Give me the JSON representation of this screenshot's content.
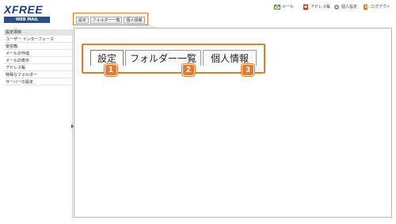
{
  "logo": {
    "word": "XFREE",
    "sub": "WEB MAIL"
  },
  "toplinks": [
    {
      "label": "メール",
      "icon": "mail-icon"
    },
    {
      "label": "アドレス帳",
      "icon": "addressbook-icon"
    },
    {
      "label": "個人設定",
      "icon": "gear-icon"
    },
    {
      "label": "ログアウト",
      "icon": "logout-icon"
    }
  ],
  "small_tabs": [
    "設定",
    "フォルダー一覧",
    "個人情報"
  ],
  "sidebar": {
    "heading": "設定項目",
    "items": [
      "ユーザー インターフェース",
      "受信箱",
      "メールの作成",
      "メールの表示",
      "アドレス帳",
      "特殊なフォルダー",
      "サーバーの設定"
    ]
  },
  "big_tabs": [
    "設定",
    "フォルダー一覧",
    "個人情報"
  ],
  "callout_numbers": [
    "1",
    "2",
    "3"
  ],
  "colors": {
    "accent": "#e07b32",
    "brand": "#1f3f7a"
  }
}
